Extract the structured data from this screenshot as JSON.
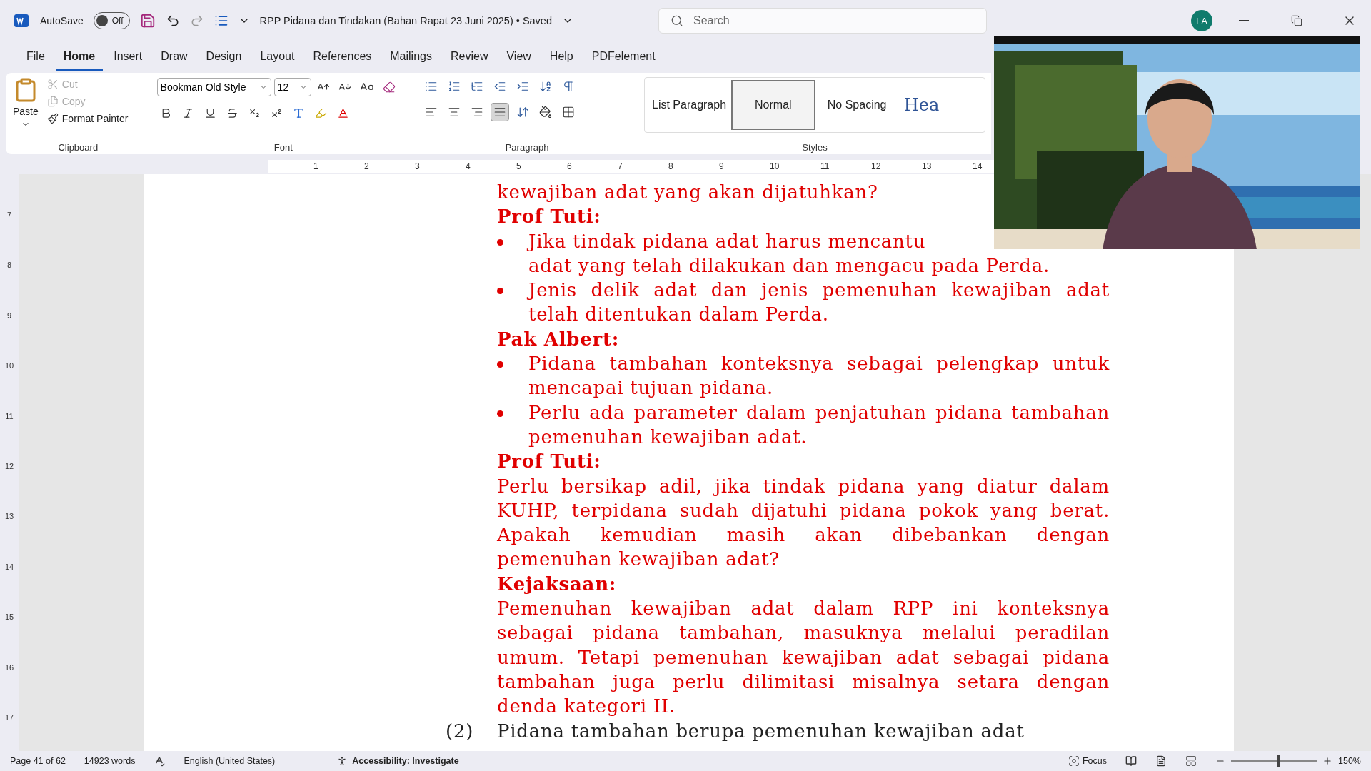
{
  "title_bar": {
    "autosave_label": "AutoSave",
    "autosave": {
      "label": "Off",
      "on": false
    },
    "document_title": "RPP Pidana dan Tindakan (Bahan Rapat 23 Juni 2025) • Saved",
    "search": {
      "placeholder": "Search"
    },
    "avatar": "LA"
  },
  "menu_tabs": [
    {
      "label": "File",
      "selected": false
    },
    {
      "label": "Home",
      "selected": true
    },
    {
      "label": "Insert",
      "selected": false
    },
    {
      "label": "Draw",
      "selected": false
    },
    {
      "label": "Design",
      "selected": false
    },
    {
      "label": "Layout",
      "selected": false
    },
    {
      "label": "References",
      "selected": false
    },
    {
      "label": "Mailings",
      "selected": false
    },
    {
      "label": "Review",
      "selected": false
    },
    {
      "label": "View",
      "selected": false
    },
    {
      "label": "Help",
      "selected": false
    },
    {
      "label": "PDFelement",
      "selected": false
    }
  ],
  "ribbon": {
    "clipboard": {
      "paste": "Paste",
      "cut": {
        "label": "Cut",
        "disabled": true
      },
      "copy": {
        "label": "Copy",
        "disabled": true
      },
      "format_painter": "Format Painter",
      "label": "Clipboard"
    },
    "font": {
      "font_name": "Bookman Old Style",
      "font_size": "12",
      "label": "Font"
    },
    "paragraph": {
      "alignments": [
        {
          "kind": "left",
          "selected": false
        },
        {
          "kind": "center",
          "selected": false
        },
        {
          "kind": "right",
          "selected": false
        },
        {
          "kind": "justify",
          "selected": true
        }
      ],
      "label": "Paragraph"
    },
    "styles": {
      "items": [
        {
          "label": "List Paragraph",
          "selected": false,
          "kind": "plain"
        },
        {
          "label": "Normal",
          "selected": true,
          "kind": "plain"
        },
        {
          "label": "No Spacing",
          "selected": false,
          "kind": "plain"
        },
        {
          "label": "Hea",
          "selected": false,
          "kind": "heading"
        }
      ],
      "label": "Styles"
    }
  },
  "horizontal_ruler": [
    "1",
    "2",
    "3",
    "4",
    "5",
    "6",
    "7",
    "8",
    "9",
    "10",
    "11",
    "12",
    "13",
    "14"
  ],
  "vertical_ruler": [
    "7",
    "8",
    "9",
    "10",
    "11",
    "12",
    "13",
    "14",
    "15",
    "16",
    "17"
  ],
  "document": [
    {
      "kind": "text",
      "text": "kewajiban adat yang akan dijatuhkan?"
    },
    {
      "kind": "heading",
      "text": "Prof Tuti:"
    },
    {
      "kind": "bullet",
      "text": "Jika tindak pidana adat harus mencantu"
    },
    {
      "kind": "continuation",
      "text": "adat yang telah dilakukan dan mengacu pada Perda."
    },
    {
      "kind": "bullet",
      "text": "Jenis delik adat dan jenis pemenuhan kewajiban adat telah ditentukan dalam Perda."
    },
    {
      "kind": "heading",
      "text": "Pak Albert:"
    },
    {
      "kind": "bullet",
      "text": "Pidana tambahan konteksnya sebagai pelengkap untuk mencapai tujuan pidana."
    },
    {
      "kind": "bullet",
      "text": "Perlu ada parameter dalam penjatuhan pidana tambahan pemenuhan kewajiban adat."
    },
    {
      "kind": "heading",
      "text": "Prof Tuti:"
    },
    {
      "kind": "text",
      "text": "Perlu bersikap adil, jika tindak pidana yang diatur dalam KUHP, terpidana sudah dijatuhi pidana pokok yang berat. Apakah kemudian masih akan dibebankan dengan pemenuhan kewajiban adat?"
    },
    {
      "kind": "heading",
      "text": "Kejaksaan:"
    },
    {
      "kind": "text",
      "text": "Pemenuhan kewajiban adat dalam RPP ini konteksnya sebagai pidana tambahan, masuknya melalui peradilan umum. Tetapi pemenuhan kewajiban adat sebagai pidana tambahan juga perlu dilimitasi misalnya setara dengan denda kategori II."
    },
    {
      "kind": "numbered",
      "number": "(2)",
      "text": "Pidana tambahan berupa pemenuhan kewajiban adat"
    }
  ],
  "video": {
    "kind": "picture"
  },
  "status_bar": {
    "page": "Page 41 of 62",
    "words": "14923 words",
    "language": "English (United States)",
    "accessibility": "Accessibility: Investigate",
    "focus": "Focus",
    "zoom": {
      "level": 0.55,
      "label": "150%"
    }
  }
}
